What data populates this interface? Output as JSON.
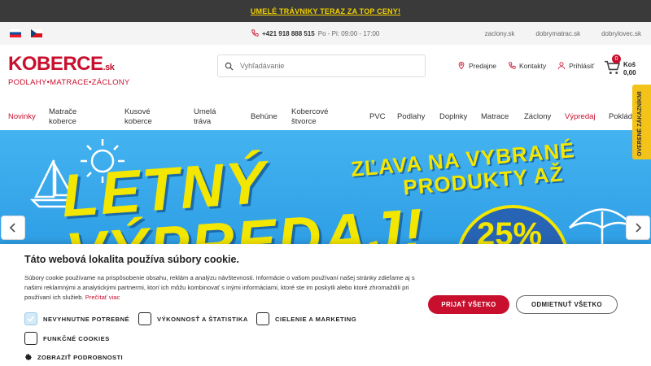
{
  "promo_bar": {
    "text": "UMELÉ TRÁVNIKY TERAZ ZA TOP CENY!"
  },
  "topbar": {
    "phone": "+421 918 888 515",
    "hours": "Po - Pi: 09:00 - 17:00",
    "links": [
      "zaclony.sk",
      "dobrymatrac.sk",
      "dobrylovec.sk"
    ]
  },
  "logo": {
    "brand": "KOBERCE",
    "suffix": ".sk",
    "tagline": "PODLAHY•MATRACE•ZÁCLONY"
  },
  "search": {
    "placeholder": "Vyhľadávanie"
  },
  "header_links": {
    "stores": "Predajne",
    "contacts": "Kontakty",
    "login": "Prihlásiť"
  },
  "cart": {
    "count": "0",
    "label": "Koš",
    "amount": "0,00"
  },
  "nav": [
    {
      "l1": "Novinky",
      "l2": ""
    },
    {
      "l1": "Matrače",
      "l2": "koberce"
    },
    {
      "l1": "Kusové",
      "l2": "koberce"
    },
    {
      "l1": "Umelá",
      "l2": "tráva"
    },
    {
      "l1": "Behúne",
      "l2": ""
    },
    {
      "l1": "Kobercové",
      "l2": "štvorce"
    },
    {
      "l1": "PVC",
      "l2": ""
    },
    {
      "l1": "Podlahy",
      "l2": ""
    },
    {
      "l1": "Doplnky",
      "l2": ""
    },
    {
      "l1": "Matrace",
      "l2": ""
    },
    {
      "l1": "Záclony",
      "l2": ""
    },
    {
      "l1": "Výpredaj",
      "l2": ""
    },
    {
      "l1": "Poklád",
      "l2": ""
    }
  ],
  "banner": {
    "line1": "LETNÝ",
    "line2": "VÝPREDAJ!",
    "promo_l1": "ZĽAVA NA VYBRANÉ",
    "promo_l2": "PRODUKTY AŽ",
    "discount": "25%"
  },
  "side_tab": {
    "text": "OVERENÉ ZÁKAZNÍKMI"
  },
  "cookie": {
    "title": "Táto webová lokalita používa súbory cookie.",
    "body": "Súbory cookie používame na prispôsobenie obsahu, reklám a analýzu návštevnosti. Informácie o vašom používaní našej stránky zdieľame aj s našimi reklamnými a analytickými partnermi, ktorí ich môžu kombinovať s inými informáciami, ktoré ste im poskytli alebo ktoré zhromaždili pri používaní ich služieb.",
    "read_more": "Prečítať viac",
    "options": [
      "NEVYHNUTNE POTREBNÉ",
      "VÝKONNOSŤ A ŠTATISTIKA",
      "CIELENIE A MARKETING",
      "FUNKČNÉ COOKIES"
    ],
    "details": "ZOBRAZIŤ PODROBNOSTI",
    "accept": "PRIJAŤ VŠETKO",
    "reject": "ODMIETNUŤ VŠETKO"
  },
  "colors": {
    "brand": "#c8102e",
    "promo_bar_bg": "#3a3a3a",
    "promo_text": "#f2d200",
    "banner_bg": "#2f9fe6",
    "banner_text": "#f3e600"
  }
}
